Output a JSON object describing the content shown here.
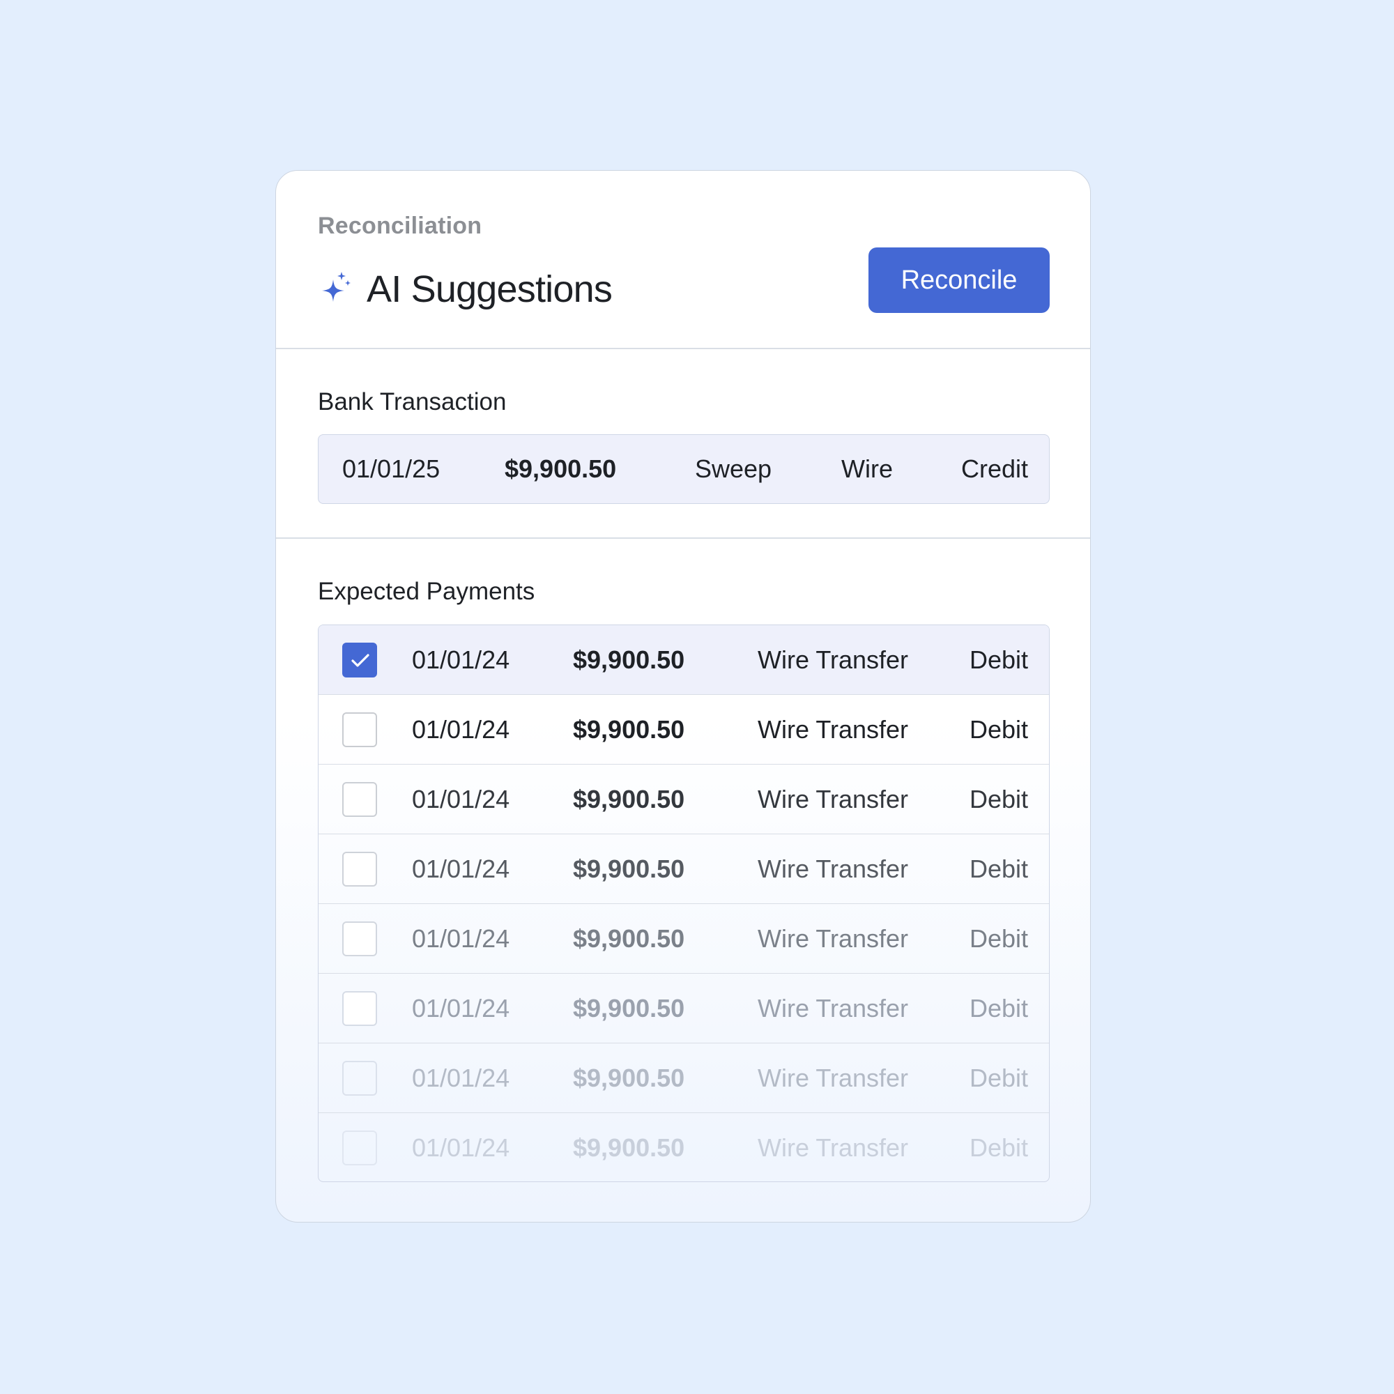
{
  "header": {
    "eyebrow": "Reconciliation",
    "title": "AI Suggestions",
    "title_icon": "sparkle-icon",
    "reconcile_label": "Reconcile"
  },
  "bank_transaction": {
    "label": "Bank Transaction",
    "date": "01/01/25",
    "amount": "$9,900.50",
    "description": "Sweep",
    "method": "Wire",
    "direction": "Credit"
  },
  "expected_payments": {
    "label": "Expected Payments",
    "rows": [
      {
        "checked": true,
        "date": "01/01/24",
        "amount": "$9,900.50",
        "method": "Wire Transfer",
        "direction": "Debit"
      },
      {
        "checked": false,
        "date": "01/01/24",
        "amount": "$9,900.50",
        "method": "Wire Transfer",
        "direction": "Debit"
      },
      {
        "checked": false,
        "date": "01/01/24",
        "amount": "$9,900.50",
        "method": "Wire Transfer",
        "direction": "Debit"
      },
      {
        "checked": false,
        "date": "01/01/24",
        "amount": "$9,900.50",
        "method": "Wire Transfer",
        "direction": "Debit"
      },
      {
        "checked": false,
        "date": "01/01/24",
        "amount": "$9,900.50",
        "method": "Wire Transfer",
        "direction": "Debit"
      },
      {
        "checked": false,
        "date": "01/01/24",
        "amount": "$9,900.50",
        "method": "Wire Transfer",
        "direction": "Debit"
      },
      {
        "checked": false,
        "date": "01/01/24",
        "amount": "$9,900.50",
        "method": "Wire Transfer",
        "direction": "Debit"
      },
      {
        "checked": false,
        "date": "01/01/24",
        "amount": "$9,900.50",
        "method": "Wire Transfer",
        "direction": "Debit"
      }
    ]
  },
  "colors": {
    "page_background": "#e3eefd",
    "accent": "#4468d4",
    "text_primary": "#1e2126",
    "text_muted": "#8c8f94",
    "row_highlight": "#eef0fb"
  }
}
